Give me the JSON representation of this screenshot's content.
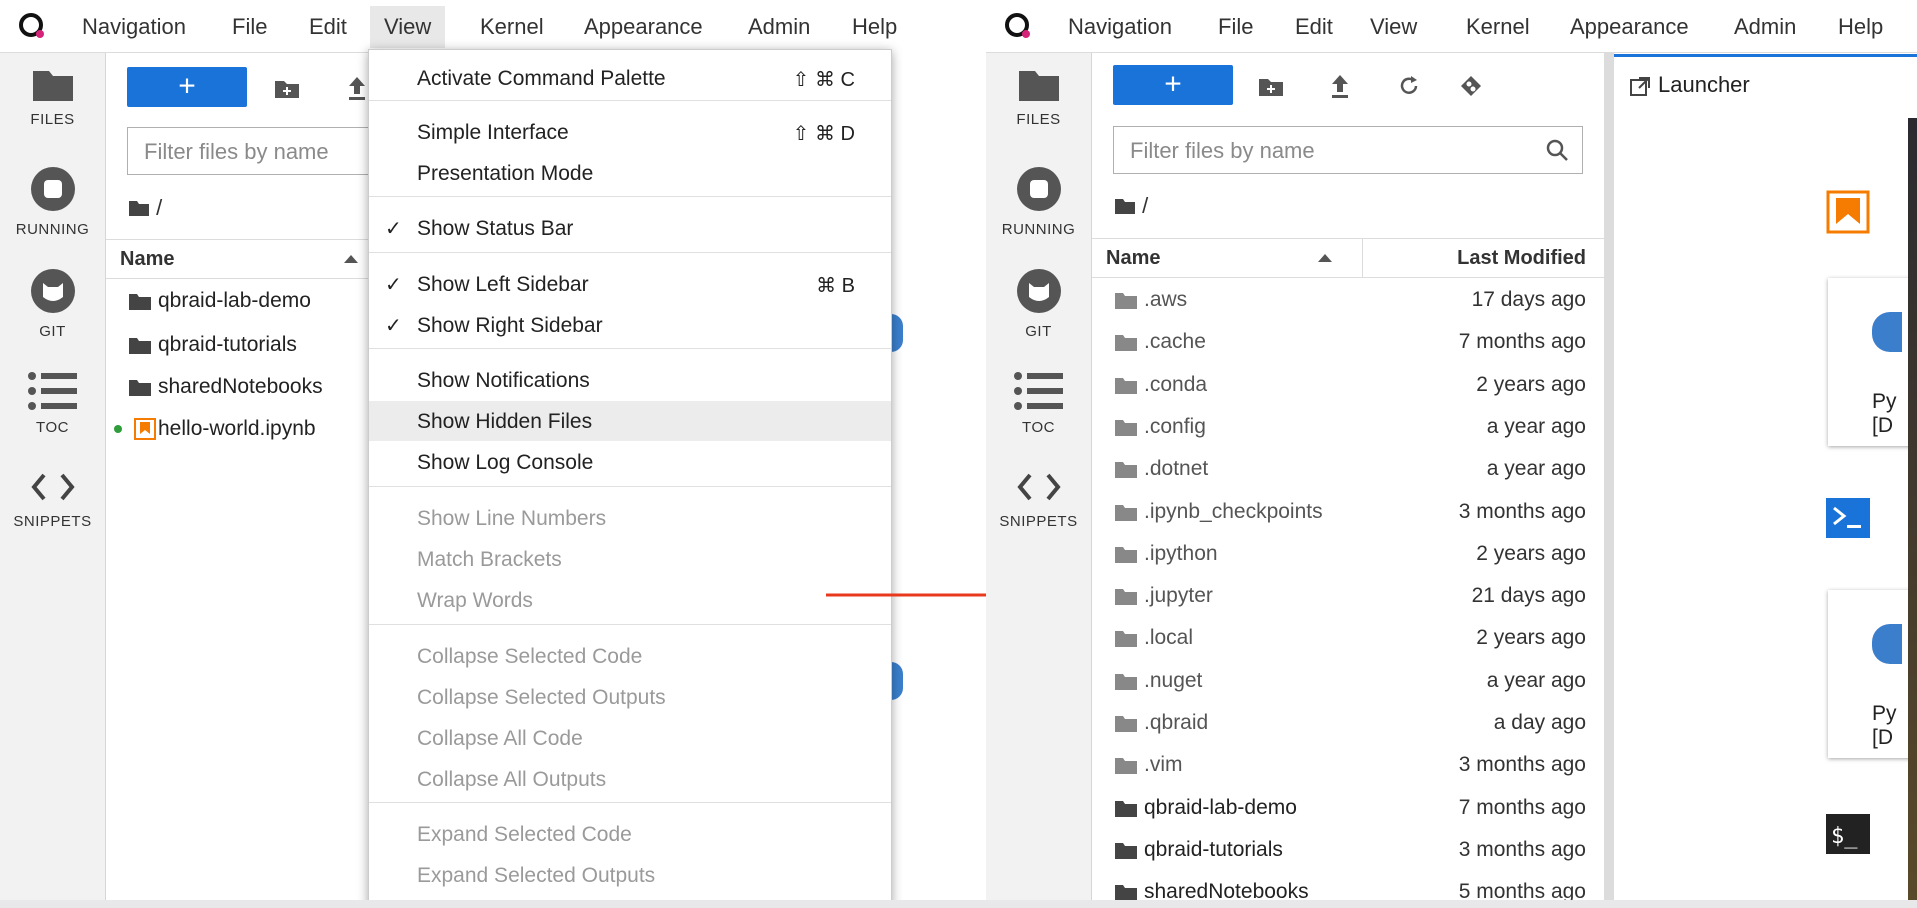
{
  "menubar": {
    "items": [
      "Navigation",
      "File",
      "Edit",
      "View",
      "Kernel",
      "Appearance",
      "Admin",
      "Help"
    ]
  },
  "sidebar": {
    "items": [
      {
        "label": "FILES",
        "icon": "folder-icon"
      },
      {
        "label": "RUNNING",
        "icon": "stop-circle-icon"
      },
      {
        "label": "GIT",
        "icon": "git-cat-icon"
      },
      {
        "label": "TOC",
        "icon": "list-icon"
      },
      {
        "label": "SNIPPETS",
        "icon": "code-brackets-icon"
      }
    ]
  },
  "toolbar": {
    "new_label": "+"
  },
  "filter": {
    "placeholder": "Filter files by name"
  },
  "breadcrumb": {
    "path": "/"
  },
  "columns": {
    "name": "Name",
    "modified": "Last Modified"
  },
  "left_files": [
    {
      "name": "qbraid-lab-demo",
      "type": "folder"
    },
    {
      "name": "qbraid-tutorials",
      "type": "folder"
    },
    {
      "name": "sharedNotebooks",
      "type": "folder"
    },
    {
      "name": "hello-world.ipynb",
      "type": "notebook"
    }
  ],
  "right_files": [
    {
      "name": ".aws",
      "modified": "17 days ago"
    },
    {
      "name": ".cache",
      "modified": "7 months ago"
    },
    {
      "name": ".conda",
      "modified": "2 years ago"
    },
    {
      "name": ".config",
      "modified": "a year ago"
    },
    {
      "name": ".dotnet",
      "modified": "a year ago"
    },
    {
      "name": ".ipynb_checkpoints",
      "modified": "3 months ago"
    },
    {
      "name": ".ipython",
      "modified": "2 years ago"
    },
    {
      "name": ".jupyter",
      "modified": "21 days ago"
    },
    {
      "name": ".local",
      "modified": "2 years ago"
    },
    {
      "name": ".nuget",
      "modified": "a year ago"
    },
    {
      "name": ".qbraid",
      "modified": "a day ago"
    },
    {
      "name": ".vim",
      "modified": "3 months ago"
    },
    {
      "name": "qbraid-lab-demo",
      "modified": "7 months ago"
    },
    {
      "name": "qbraid-tutorials",
      "modified": "3 months ago"
    },
    {
      "name": "sharedNotebooks",
      "modified": "5 months ago"
    }
  ],
  "view_menu": [
    {
      "label": "Activate Command Palette",
      "shortcut": "⇧ ⌘ C"
    },
    {
      "label": "Simple Interface",
      "shortcut": "⇧ ⌘ D"
    },
    {
      "label": "Presentation Mode",
      "shortcut": ""
    },
    {
      "label": "Show Status Bar",
      "shortcut": "",
      "checked": "✓"
    },
    {
      "label": "Show Left Sidebar",
      "shortcut": "⌘ B",
      "checked": "✓"
    },
    {
      "label": "Show Right Sidebar",
      "shortcut": "",
      "checked": "✓"
    },
    {
      "label": "Show Notifications",
      "shortcut": ""
    },
    {
      "label": "Show Hidden Files",
      "shortcut": ""
    },
    {
      "label": "Show Log Console",
      "shortcut": ""
    },
    {
      "label": "Show Line Numbers",
      "shortcut": ""
    },
    {
      "label": "Match Brackets",
      "shortcut": ""
    },
    {
      "label": "Wrap Words",
      "shortcut": ""
    },
    {
      "label": "Collapse Selected Code",
      "shortcut": ""
    },
    {
      "label": "Collapse Selected Outputs",
      "shortcut": ""
    },
    {
      "label": "Collapse All Code",
      "shortcut": ""
    },
    {
      "label": "Collapse All Outputs",
      "shortcut": ""
    },
    {
      "label": "Expand Selected Code",
      "shortcut": ""
    },
    {
      "label": "Expand Selected Outputs",
      "shortcut": ""
    }
  ],
  "launcher": {
    "tab_label": "Launcher",
    "card_texts": [
      "Py",
      "[D",
      "Py",
      "[D"
    ],
    "underlay_texts": [
      "y",
      "D",
      "y",
      "D"
    ]
  },
  "colors": {
    "accent": "#1a73d8",
    "arrow": "#e8391d",
    "logo": "#7a2bd6",
    "notebook": "#f57c00",
    "running_dot": "#2e9d3a"
  }
}
